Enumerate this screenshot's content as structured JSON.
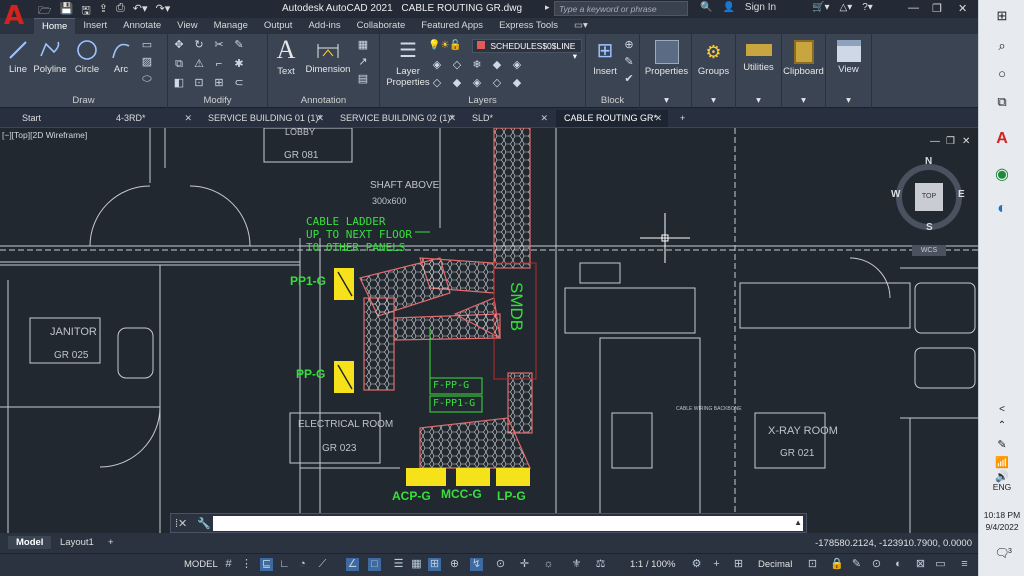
{
  "titlebar": {
    "app": "Autodesk AutoCAD 2021",
    "file": "CABLE ROUTING GR.dwg",
    "search_placeholder": "Type a keyword or phrase",
    "signin": "Sign In"
  },
  "menu_tabs": [
    "Home",
    "Insert",
    "Annotate",
    "View",
    "Manage",
    "Output",
    "Add-ins",
    "Collaborate",
    "Featured Apps",
    "Express Tools"
  ],
  "ribbon": {
    "draw": {
      "title": "Draw",
      "line": "Line",
      "polyline": "Polyline",
      "circle": "Circle",
      "arc": "Arc"
    },
    "modify": {
      "title": "Modify"
    },
    "annotation": {
      "title": "Annotation",
      "text": "Text",
      "dimension": "Dimension"
    },
    "layers": {
      "title": "Layers",
      "layer_properties_1": "Layer",
      "layer_properties_2": "Properties",
      "current_layer": "SCHEDULES$0$LINE"
    },
    "block": {
      "title": "Block",
      "insert": "Insert"
    },
    "properties": "Properties",
    "groups": "Groups",
    "utilities": "Utilities",
    "clipboard": "Clipboard",
    "view": "View"
  },
  "doc_tabs": [
    {
      "label": "Start"
    },
    {
      "label": "4-3RD*"
    },
    {
      "label": "SERVICE BUILDING 01 (1)*"
    },
    {
      "label": "SERVICE BUILDING 02 (1)*"
    },
    {
      "label": "SLD*"
    },
    {
      "label": "CABLE ROUTING GR*"
    }
  ],
  "viewport": {
    "label": "[−][Top][2D Wireframe]",
    "viewcube_top": "TOP",
    "compass": {
      "n": "N",
      "s": "S",
      "e": "E",
      "w": "W"
    },
    "wcs": "WCS"
  },
  "drawing": {
    "lobby": "LOBBY",
    "lobby_no": "GR 081",
    "shaft": "SHAFT ABOVE",
    "shaft_size": "300x600",
    "cable_note_1": "CABLE LADDER",
    "cable_note_2": "UP TO NEXT FLOOR",
    "cable_note_3": "TO OTHER PANELS",
    "janitor": "JANITOR",
    "janitor_no": "GR 025",
    "electrical": "ELECTRICAL ROOM",
    "electrical_no": "GR 023",
    "xray": "X-RAY ROOM",
    "xray_no": "GR 021",
    "pp1g": "PP1-G",
    "ppg": "PP-G",
    "acpg": "ACP-G",
    "mccg": "MCC-G",
    "lpg": "LP-G",
    "fppg": "F-PP-G",
    "fpp1g": "F-PP1-G",
    "smdb": "SMDB",
    "small_text": "CABLE WIRING BACKBONE"
  },
  "command_line": {
    "value": ""
  },
  "layout_tabs": [
    "Model",
    "Layout1"
  ],
  "coordinates": "-178580.2124, -123910.7900, 0.0000",
  "status": {
    "model": "MODEL",
    "scale": "1:1 / 100%",
    "units": "Decimal"
  },
  "taskbar": {
    "lang": "ENG",
    "time": "10:18 PM",
    "date": "9/4/2022",
    "notifications": "3"
  }
}
